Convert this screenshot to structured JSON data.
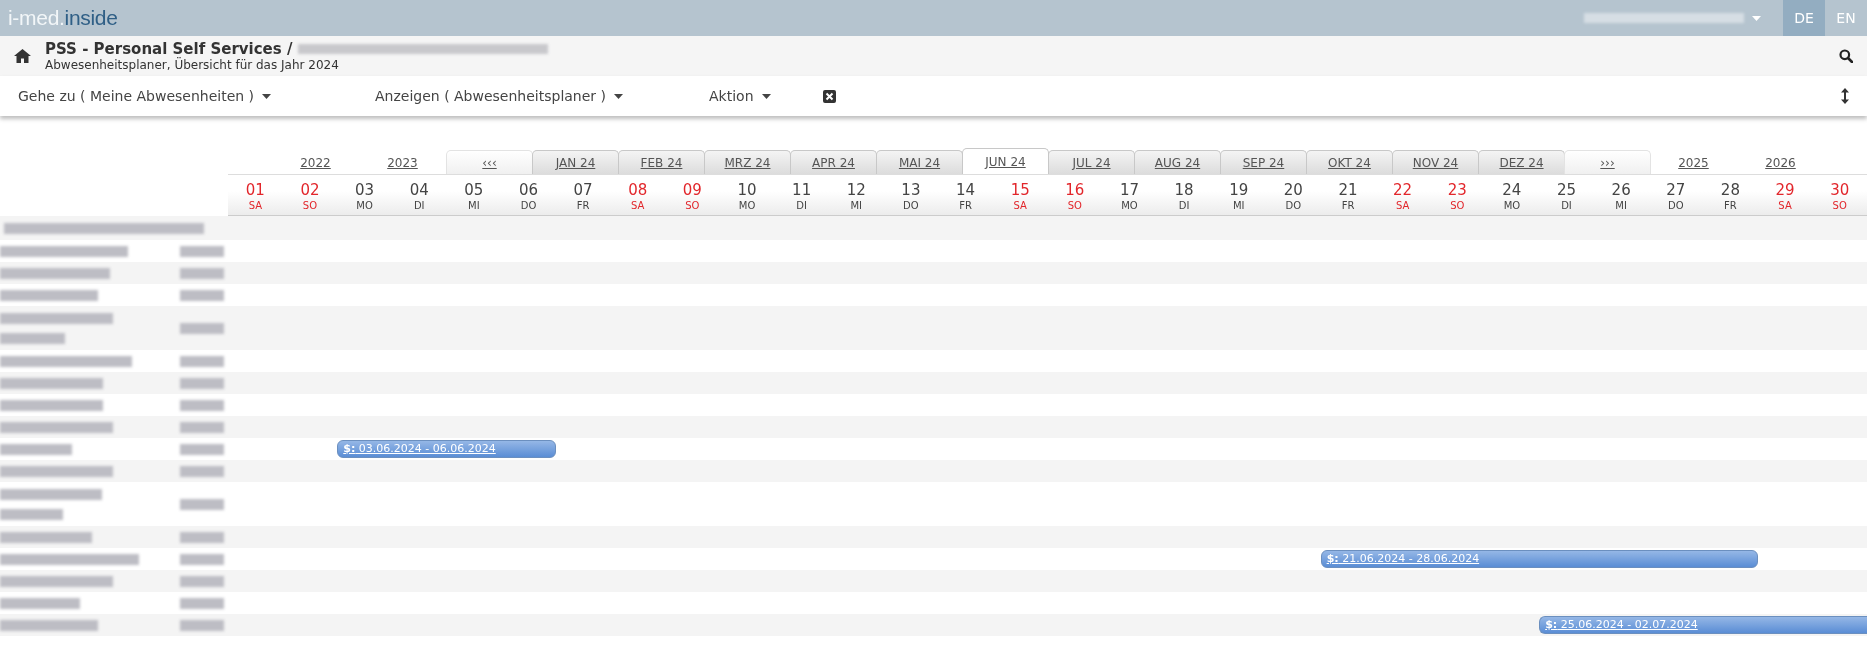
{
  "topbar": {
    "logo": {
      "prefix": "i-med.",
      "suffix": "inside"
    },
    "languages": [
      {
        "label": "DE",
        "selected": true
      },
      {
        "label": "EN",
        "selected": false
      }
    ]
  },
  "header": {
    "title": "PSS - Personal Self Services /",
    "subtitle": "Abwesenheitsplaner, Übersicht für das Jahr 2024"
  },
  "toolbar": {
    "menus": [
      {
        "label": "Gehe zu ( Meine Abwesenheiten )"
      },
      {
        "label": "Anzeigen ( Abwesenheitsplaner )"
      },
      {
        "label": "Aktion"
      }
    ]
  },
  "planner": {
    "years_before": [
      "2022",
      "2023"
    ],
    "prev": "‹‹‹",
    "months": [
      {
        "label": "JAN 24",
        "selected": false
      },
      {
        "label": "FEB 24",
        "selected": false
      },
      {
        "label": "MRZ 24",
        "selected": false
      },
      {
        "label": "APR 24",
        "selected": false
      },
      {
        "label": "MAI 24",
        "selected": false
      },
      {
        "label": "JUN 24",
        "selected": true
      },
      {
        "label": "JUL 24",
        "selected": false
      },
      {
        "label": "AUG 24",
        "selected": false
      },
      {
        "label": "SEP 24",
        "selected": false
      },
      {
        "label": "OKT 24",
        "selected": false
      },
      {
        "label": "NOV 24",
        "selected": false
      },
      {
        "label": "DEZ 24",
        "selected": false
      }
    ],
    "next": "›››",
    "years_after": [
      "2025",
      "2026"
    ],
    "days": [
      {
        "day": "01",
        "weekday": "SA",
        "weekend": true
      },
      {
        "day": "02",
        "weekday": "SO",
        "weekend": true
      },
      {
        "day": "03",
        "weekday": "MO",
        "weekend": false
      },
      {
        "day": "04",
        "weekday": "DI",
        "weekend": false
      },
      {
        "day": "05",
        "weekday": "MI",
        "weekend": false
      },
      {
        "day": "06",
        "weekday": "DO",
        "weekend": false
      },
      {
        "day": "07",
        "weekday": "FR",
        "weekend": false
      },
      {
        "day": "08",
        "weekday": "SA",
        "weekend": true
      },
      {
        "day": "09",
        "weekday": "SO",
        "weekend": true
      },
      {
        "day": "10",
        "weekday": "MO",
        "weekend": false
      },
      {
        "day": "11",
        "weekday": "DI",
        "weekend": false
      },
      {
        "day": "12",
        "weekday": "MI",
        "weekend": false
      },
      {
        "day": "13",
        "weekday": "DO",
        "weekend": false
      },
      {
        "day": "14",
        "weekday": "FR",
        "weekend": false
      },
      {
        "day": "15",
        "weekday": "SA",
        "weekend": true
      },
      {
        "day": "16",
        "weekday": "SO",
        "weekend": true
      },
      {
        "day": "17",
        "weekday": "MO",
        "weekend": false
      },
      {
        "day": "18",
        "weekday": "DI",
        "weekend": false
      },
      {
        "day": "19",
        "weekday": "MI",
        "weekend": false
      },
      {
        "day": "20",
        "weekday": "DO",
        "weekend": false
      },
      {
        "day": "21",
        "weekday": "FR",
        "weekend": false
      },
      {
        "day": "22",
        "weekday": "SA",
        "weekend": true
      },
      {
        "day": "23",
        "weekday": "SO",
        "weekend": true
      },
      {
        "day": "24",
        "weekday": "MO",
        "weekend": false
      },
      {
        "day": "25",
        "weekday": "DI",
        "weekend": false
      },
      {
        "day": "26",
        "weekday": "MI",
        "weekend": false
      },
      {
        "day": "27",
        "weekday": "DO",
        "weekend": false
      },
      {
        "day": "28",
        "weekday": "FR",
        "weekend": false
      },
      {
        "day": "29",
        "weekday": "SA",
        "weekend": true
      },
      {
        "day": "30",
        "weekday": "SO",
        "weekend": true
      }
    ],
    "rows": [
      {
        "kind": "group"
      },
      {
        "kind": "person"
      },
      {
        "kind": "person"
      },
      {
        "kind": "person"
      },
      {
        "kind": "person-wrapped"
      },
      {
        "kind": "person"
      },
      {
        "kind": "person"
      },
      {
        "kind": "person"
      },
      {
        "kind": "person"
      },
      {
        "kind": "person",
        "absence": {
          "label": "**$:** 03.06.2024 - 06.06.2024",
          "continues": false
        }
      },
      {
        "kind": "person"
      },
      {
        "kind": "person-wrapped"
      },
      {
        "kind": "person"
      },
      {
        "kind": "person",
        "absence": {
          "label": "**$:** 21.06.2024 - 28.06.2024",
          "continues": false
        }
      },
      {
        "kind": "person"
      },
      {
        "kind": "person"
      },
      {
        "kind": "person",
        "absence": {
          "label": "**$:** 25.06.2024 - 02.07.2024",
          "continues": true
        }
      }
    ]
  }
}
